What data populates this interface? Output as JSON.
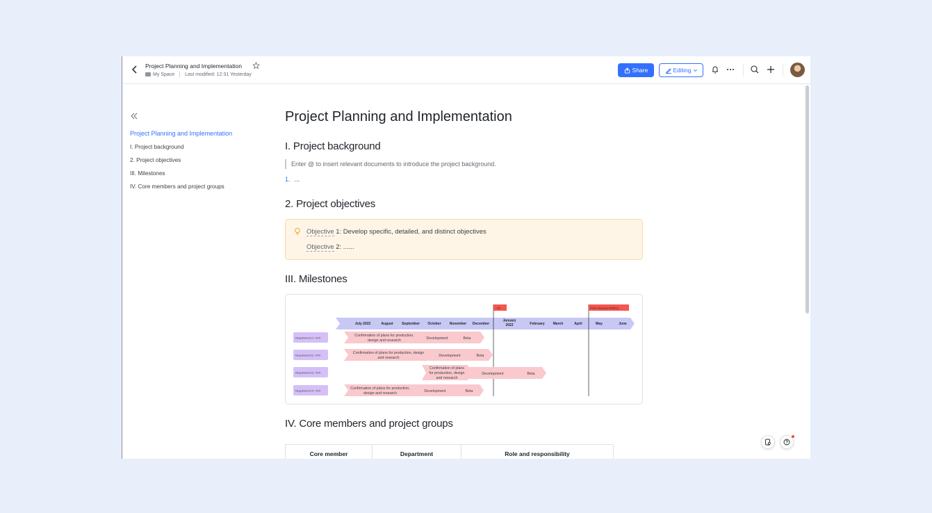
{
  "header": {
    "title": "Project Planning and Implementation",
    "location": "My Space",
    "last_modified": "Last modified: 12:31 Yesterday",
    "share_label": "Share",
    "editing_label": "Editing",
    "icons": [
      "back-icon",
      "star-icon",
      "folder-icon",
      "share-icon",
      "pen-icon",
      "chevron-down-icon",
      "bell-icon",
      "more-icon",
      "search-icon",
      "plus-icon"
    ]
  },
  "toc": {
    "items": [
      "Project Planning and Implementation",
      "I. Project background",
      "2. Project objectives",
      "III. Milestones",
      "IV. Core members and project groups"
    ]
  },
  "doc": {
    "title": "Project Planning and Implementation",
    "sections": {
      "background": {
        "heading": "I. Project background",
        "quote": "Enter @ to insert relevant documents to introduce the project background.",
        "list_num": "1.",
        "list_text": "..."
      },
      "objectives": {
        "heading": "2. Project objectives",
        "obj1_label": "Objective",
        "obj1_rest": " 1: Develop specific, detailed, and distinct objectives",
        "obj2_label": "Objective",
        "obj2_rest": " 2: ......"
      },
      "milestones": {
        "heading": "III. Milestones"
      },
      "members": {
        "heading": "IV. Core members and project groups",
        "columns": [
          "Core member",
          "Department",
          "Role and responsibility"
        ]
      }
    }
  },
  "gantt": {
    "months": [
      "July 2022",
      "August",
      "September",
      "October",
      "November",
      "December",
      "January",
      "February",
      "March",
      "April",
      "May",
      "June"
    ],
    "january_year": "2023",
    "flags": [
      "AC",
      "Press Release Briefing"
    ],
    "requirements": [
      "Requirement 1: XXX",
      "Requirement 2: XXX",
      "Requirement 3: XXX",
      "Requirement 4: XXX"
    ],
    "task_plan_1": "Confirmation of plans for production,",
    "task_plan_1b": "design and research",
    "task_plan_2": "Confirmation of plans for production, design",
    "task_plan_2b": "and research",
    "task_plan_3": "Confirmation of plans",
    "task_plan_3b": "for production, design",
    "task_plan_3c": "and research",
    "task_plan_4": "Confirmation of plans for production,",
    "task_plan_4b": "design and research",
    "task_dev": "Development",
    "task_beta": "Beta",
    "colors": {
      "timeline": "#c8c8f5",
      "requirement": "#d4c0f7",
      "task": "#f9c9cd",
      "flag": "#f5564f"
    }
  },
  "colors": {
    "accent": "#3370ff",
    "background": "#e8effb",
    "callout": "#fef5e7"
  }
}
